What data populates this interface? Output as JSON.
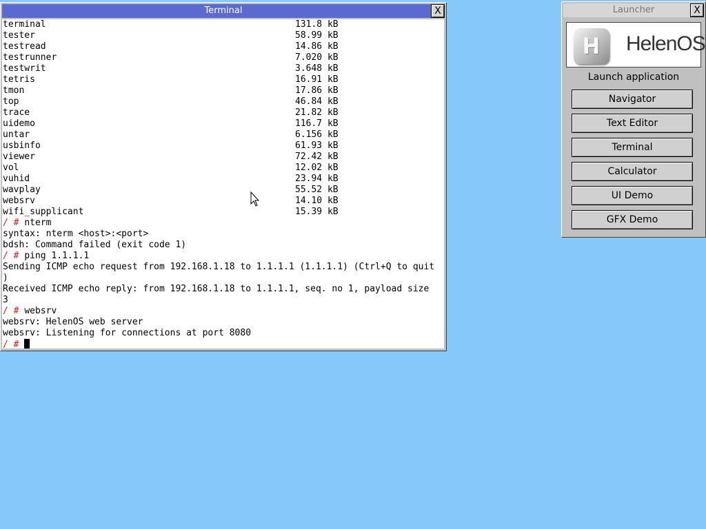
{
  "terminal": {
    "title": "Terminal",
    "close_glyph": "X",
    "files": [
      {
        "name": "terminal",
        "size": "131.8 kB"
      },
      {
        "name": "tester",
        "size": "58.99 kB"
      },
      {
        "name": "testread",
        "size": "14.86 kB"
      },
      {
        "name": "testrunner",
        "size": "7.020 kB"
      },
      {
        "name": "testwrit",
        "size": "3.648 kB"
      },
      {
        "name": "tetris",
        "size": "16.91 kB"
      },
      {
        "name": "tmon",
        "size": "17.86 kB"
      },
      {
        "name": "top",
        "size": "46.84 kB"
      },
      {
        "name": "trace",
        "size": "21.82 kB"
      },
      {
        "name": "uidemo",
        "size": "116.7 kB"
      },
      {
        "name": "untar",
        "size": "6.156 kB"
      },
      {
        "name": "usbinfo",
        "size": "61.93 kB"
      },
      {
        "name": "viewer",
        "size": "72.42 kB"
      },
      {
        "name": "vol",
        "size": "12.02 kB"
      },
      {
        "name": "vuhid",
        "size": "23.94 kB"
      },
      {
        "name": "wavplay",
        "size": "55.52 kB"
      },
      {
        "name": "websrv",
        "size": "14.10 kB"
      },
      {
        "name": "wifi_supplicant",
        "size": "15.39 kB"
      }
    ],
    "prompt": "/ #",
    "cmd_nterm": "nterm",
    "nterm_syntax": "syntax: nterm <host>:<port>",
    "nterm_error": "bdsh: Command failed (exit code 1)",
    "cmd_ping": "ping 1.1.1.1",
    "ping_send_1": "Sending ICMP echo request from 192.168.1.18 to 1.1.1.1 (1.1.1.1) (Ctrl+Q to quit",
    "ping_send_2": ")",
    "ping_reply_1": "Received ICMP echo reply: from 192.168.1.18 to 1.1.1.1, seq. no 1, payload size",
    "ping_reply_2": "3",
    "cmd_websrv": "websrv",
    "websrv_1": "websrv: HelenOS web server",
    "websrv_2": "websrv: Listening for connections at port 8080"
  },
  "launcher": {
    "title": "Launcher",
    "close_glyph": "X",
    "logo_letter": "H",
    "logo_text": "HelenOS",
    "label": "Launch application",
    "apps": [
      "Navigator",
      "Text Editor",
      "Terminal",
      "Calculator",
      "UI Demo",
      "GFX Demo"
    ]
  },
  "colors": {
    "desktop": "#87c8fa",
    "active_title": "#5a6acf",
    "prompt": "#d02020"
  },
  "pointer_icon": "arrow-pointer-icon"
}
